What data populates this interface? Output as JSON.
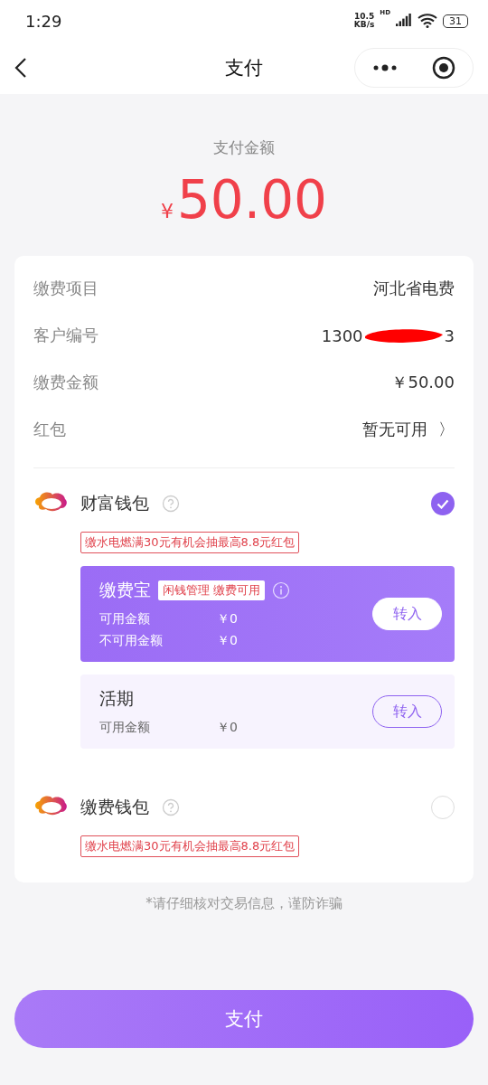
{
  "status_bar": {
    "time": "1:29",
    "speed_value": "10.5",
    "speed_unit": "KB/s",
    "network": "HD",
    "battery": "31"
  },
  "nav": {
    "title": "支付"
  },
  "amount": {
    "label": "支付金额",
    "currency": "¥",
    "value": "50.00"
  },
  "details": [
    {
      "label": "缴费项目",
      "value": "河北省电费"
    },
    {
      "label": "客户编号",
      "value": "1300",
      "value_end": "3",
      "redacted": true
    },
    {
      "label": "缴费金额",
      "value": "￥50.00"
    },
    {
      "label": "红包",
      "value": "暂无可用",
      "chevron": "〉"
    }
  ],
  "wallets": [
    {
      "name": "财富钱包",
      "selected": true,
      "promo": "缴水电燃满30元有机会抽最高8.8元红包",
      "accounts": [
        {
          "kind": "featured",
          "name": "缴费宝",
          "tag": "闲钱管理 缴费可用",
          "button": "转入",
          "lines": [
            {
              "label": "可用金额",
              "value": "￥0"
            },
            {
              "label": "不可用金额",
              "value": "￥0"
            }
          ]
        },
        {
          "kind": "plain",
          "name": "活期",
          "button": "转入",
          "lines": [
            {
              "label": "可用金额",
              "value": "￥0"
            }
          ]
        }
      ]
    },
    {
      "name": "缴费钱包",
      "selected": false,
      "promo": "缴水电燃满30元有机会抽最高8.8元红包"
    }
  ],
  "notice": "*请仔细核对交易信息，谨防诈骗",
  "pay_button": "支付"
}
